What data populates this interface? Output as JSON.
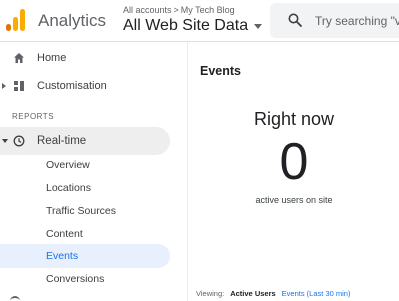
{
  "header": {
    "app_title": "Analytics",
    "breadcrumb": {
      "accounts": "All accounts",
      "separator": ">",
      "property": "My Tech Blog"
    },
    "view_name": "All Web Site Data",
    "search_placeholder": "Try searching \"v"
  },
  "sidebar": {
    "home": "Home",
    "customisation": "Customisation",
    "section_reports": "REPORTS",
    "realtime": "Real-time",
    "realtime_items": [
      {
        "label": "Overview"
      },
      {
        "label": "Locations"
      },
      {
        "label": "Traffic Sources"
      },
      {
        "label": "Content"
      },
      {
        "label": "Events",
        "active": true
      },
      {
        "label": "Conversions"
      }
    ]
  },
  "main": {
    "title": "Events",
    "right_now_label": "Right now",
    "active_count": "0",
    "active_caption": "active users on site",
    "viewing_label": "Viewing:",
    "viewing_tabs": [
      "Active Users",
      "Events (Last 30 min)"
    ]
  },
  "colors": {
    "accent": "#1a73e8",
    "active_bg": "#e8f0fe",
    "logo_orange": "#e37400",
    "logo_yellow": "#f9ab00"
  }
}
